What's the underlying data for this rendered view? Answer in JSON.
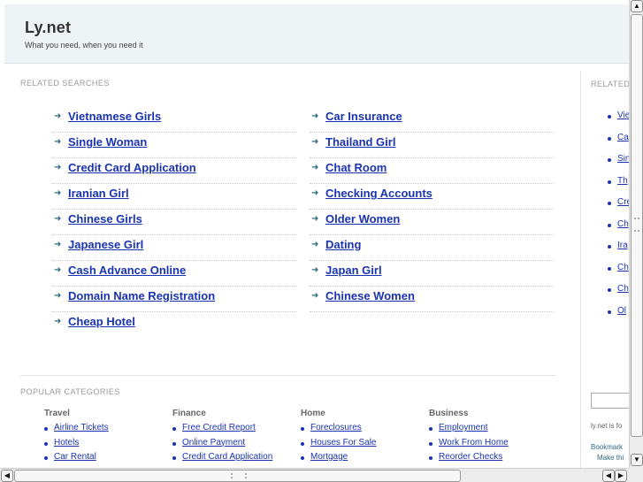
{
  "header": {
    "title": "Ly.net",
    "tagline": "What you need, when you need it"
  },
  "related_searches": {
    "label": "RELATED SEARCHES",
    "rows": [
      [
        "Vietnamese Girls",
        "Car Insurance"
      ],
      [
        "Single Woman",
        "Thailand Girl"
      ],
      [
        "Credit Card Application",
        "Chat Room"
      ],
      [
        "Iranian Girl",
        "Checking Accounts"
      ],
      [
        "Chinese Girls",
        "Older Women"
      ],
      [
        "Japanese Girl",
        "Dating"
      ],
      [
        "Cash Advance Online",
        "Japan Girl"
      ],
      [
        "Domain Name Registration",
        "Chinese Women"
      ],
      [
        "Cheap Hotel",
        ""
      ]
    ]
  },
  "popular_categories": {
    "label": "POPULAR CATEGORIES",
    "columns": [
      {
        "title": "Travel",
        "links": [
          "Airline Tickets",
          "Hotels",
          "Car Rental"
        ]
      },
      {
        "title": "Finance",
        "links": [
          "Free Credit Report",
          "Online Payment",
          "Credit Card Application"
        ]
      },
      {
        "title": "Home",
        "links": [
          "Foreclosures",
          "Houses For Sale",
          "Mortgage"
        ]
      },
      {
        "title": "Business",
        "links": [
          "Employment",
          "Work From Home",
          "Reorder Checks"
        ]
      }
    ]
  },
  "sidebar": {
    "label": "RELATED",
    "links": [
      "Vie",
      "Ca",
      "Sin",
      "Th",
      "Cre",
      "Ch",
      "Ira",
      "Ch",
      "Ch",
      "Ol"
    ],
    "note": "ly.net is fo",
    "bookmark_line1": "Bookmark",
    "bookmark_line2": "Make thi"
  },
  "icons": {
    "search_arrow": "right-arrow-icon",
    "bullet": "bullet-dot-icon"
  },
  "colors": {
    "link": "#1a33b0",
    "header_bg": "#eef3f6",
    "arrow": "#2a6b7c"
  }
}
